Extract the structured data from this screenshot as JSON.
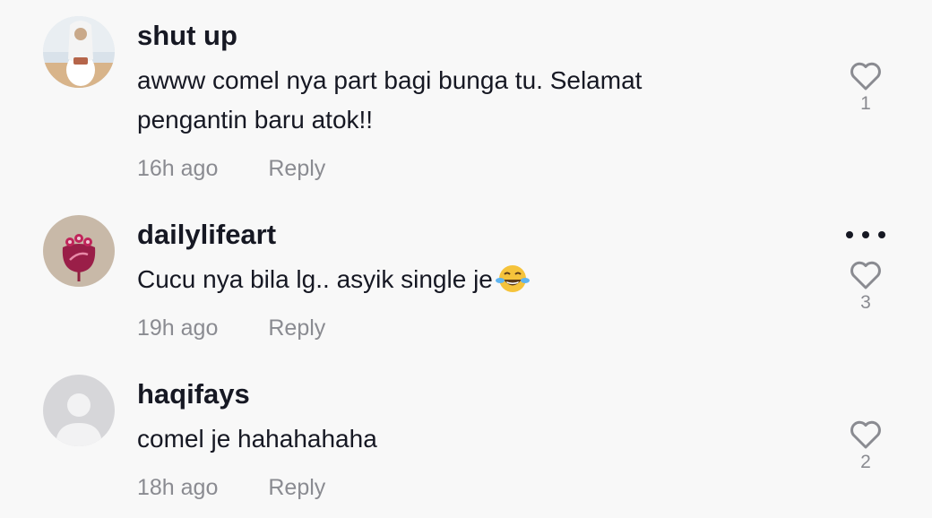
{
  "comments": [
    {
      "username": "shut up",
      "text": "awww comel nya part bagi bunga tu. Selamat pengantin baru atok!!",
      "time": "16h ago",
      "reply_label": "Reply",
      "likes": "1"
    },
    {
      "username": "dailylifeart",
      "text": "Cucu nya bila lg.. asyik single je",
      "emoji": "face-with-tears-of-joy",
      "time": "19h ago",
      "reply_label": "Reply",
      "likes": "3"
    },
    {
      "username": "haqifays",
      "text": "comel je hahahahaha",
      "time": "18h ago",
      "reply_label": "Reply",
      "likes": "2"
    }
  ],
  "colors": {
    "background": "#f8f8f8",
    "primary_text": "#161823",
    "secondary_text": "#8a8b91"
  }
}
